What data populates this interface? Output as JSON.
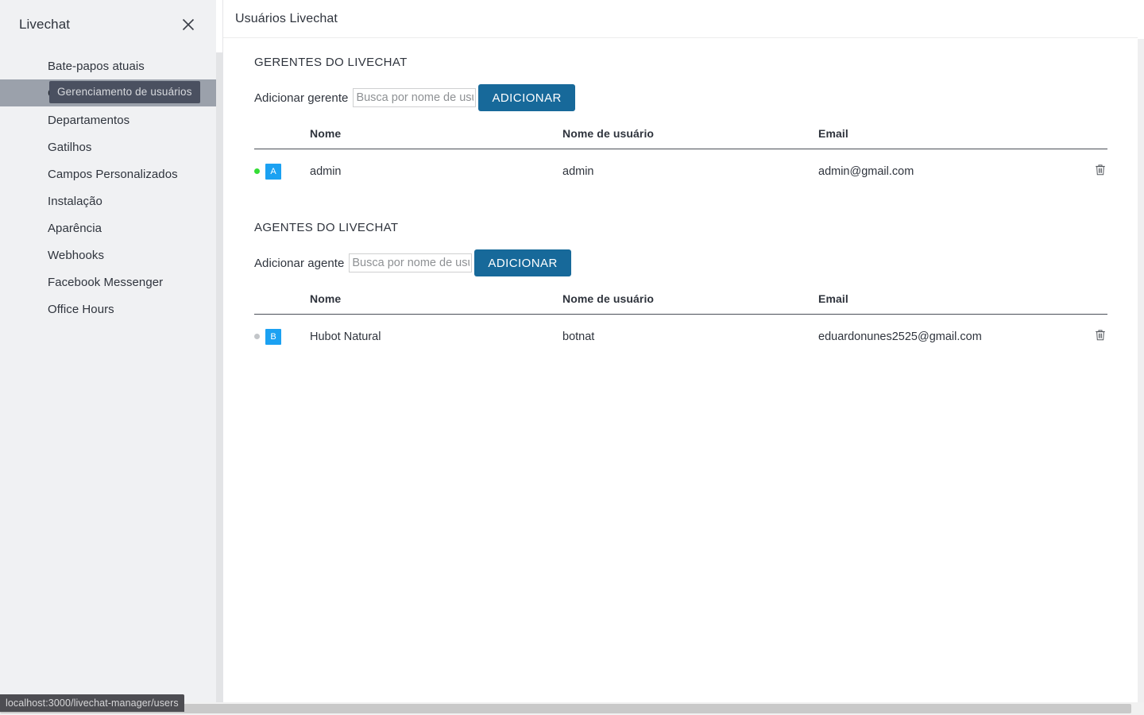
{
  "sidebar": {
    "title": "Livechat",
    "close_icon": "close-icon",
    "active_tooltip": "Gerenciamento de usuários",
    "items": [
      {
        "label": "Bate-papos atuais",
        "active": false
      },
      {
        "label": "Gerenciamento de usuários",
        "active": true
      },
      {
        "label": "Departamentos",
        "active": false
      },
      {
        "label": "Gatilhos",
        "active": false
      },
      {
        "label": "Campos Personalizados",
        "active": false
      },
      {
        "label": "Instalação",
        "active": false
      },
      {
        "label": "Aparência",
        "active": false
      },
      {
        "label": "Webhooks",
        "active": false
      },
      {
        "label": "Facebook Messenger",
        "active": false
      },
      {
        "label": "Office Hours",
        "active": false
      }
    ]
  },
  "header": {
    "title": "Usuários Livechat"
  },
  "sections": [
    {
      "title": "GERENTES DO LIVECHAT",
      "add_label": "Adicionar gerente",
      "input_value": "",
      "input_placeholder": "Busca por nome de usuário",
      "add_button": "ADICIONAR",
      "columns": [
        "Nome",
        "Nome de usuário",
        "Email"
      ],
      "rows": [
        {
          "status": "online",
          "avatar_letter": "A",
          "name": "admin",
          "username": "admin",
          "email": "admin@gmail.com",
          "delete_icon": "trash-icon"
        }
      ]
    },
    {
      "title": "AGENTES DO LIVECHAT",
      "add_label": "Adicionar agente",
      "input_value": "",
      "input_placeholder": "Busca por nome de usuário",
      "add_button": "ADICIONAR",
      "columns": [
        "Nome",
        "Nome de usuário",
        "Email"
      ],
      "rows": [
        {
          "status": "offline",
          "avatar_letter": "B",
          "name": "Hubot Natural",
          "username": "botnat",
          "email": "eduardonunes2525@gmail.com",
          "delete_icon": "trash-icon"
        }
      ]
    }
  ],
  "status_bar": {
    "url": "localhost:3000/livechat-manager/users"
  },
  "colors": {
    "accent_button": "#17699a",
    "avatar": "#1ba1f2",
    "status_online": "#35dd36",
    "status_offline": "#c3c6c9",
    "sidebar_bg": "#f0f1f3",
    "active_item_bg": "#9ba1ab",
    "tooltip_bg": "#4a5060",
    "status_bar_bg": "#4d4d52"
  }
}
